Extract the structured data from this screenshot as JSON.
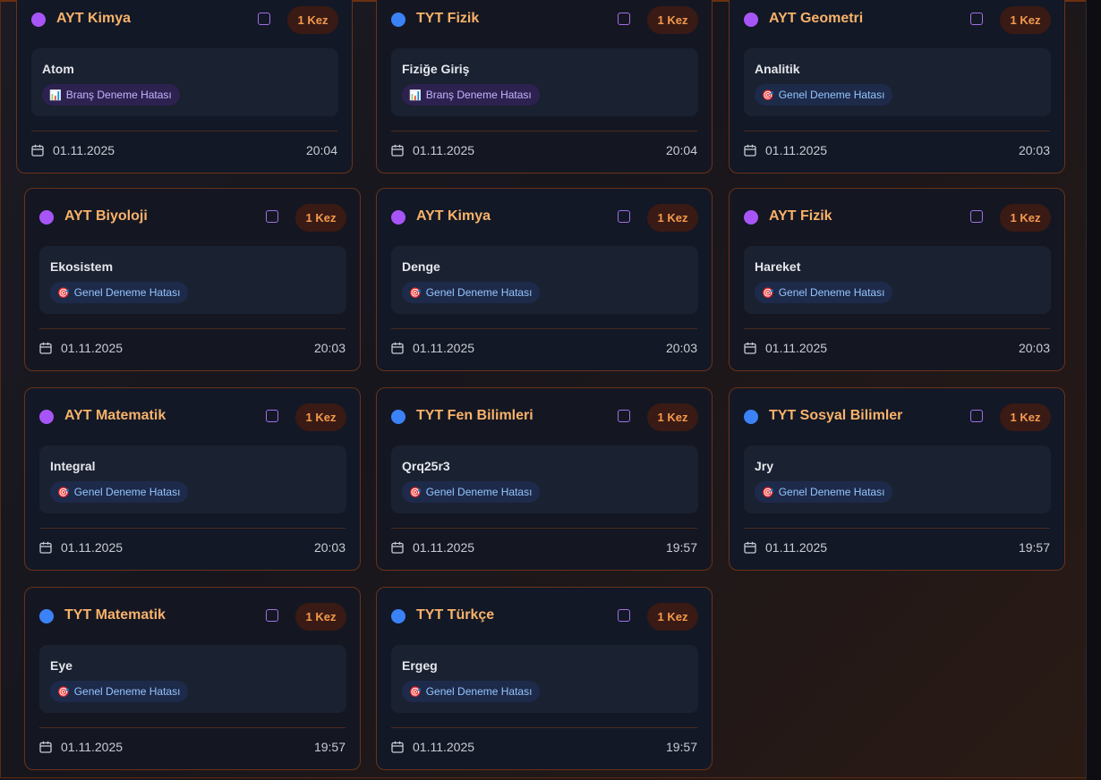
{
  "colors": {
    "ayt_dot": "#a855f7",
    "tyt_dot": "#3b82f6",
    "title": "#f8b26a",
    "badge_text": "#f39a4e"
  },
  "cards": [
    {
      "subject": "AYT Kimya",
      "dot": "ayt",
      "badge": "1 Kez",
      "topic": "Atom",
      "tag_icon": "bar-chart-icon",
      "tag_glyph": "📊",
      "tag": "Branş Deneme Hatası",
      "tag_type": "brans",
      "date": "01.11.2025",
      "time": "20:04"
    },
    {
      "subject": "TYT Fizik",
      "dot": "tyt",
      "badge": "1 Kez",
      "topic": "Fiziğe Giriş",
      "tag_icon": "bar-chart-icon",
      "tag_glyph": "📊",
      "tag": "Branş Deneme Hatası",
      "tag_type": "brans",
      "date": "01.11.2025",
      "time": "20:04"
    },
    {
      "subject": "AYT Geometri",
      "dot": "ayt",
      "badge": "1 Kez",
      "topic": "Analitik",
      "tag_icon": "target-icon",
      "tag_glyph": "🎯",
      "tag": "Genel Deneme Hatası",
      "tag_type": "genel",
      "date": "01.11.2025",
      "time": "20:03"
    },
    {
      "subject": "AYT Biyoloji",
      "dot": "ayt",
      "badge": "1 Kez",
      "topic": "Ekosistem",
      "tag_icon": "target-icon",
      "tag_glyph": "🎯",
      "tag": "Genel Deneme Hatası",
      "tag_type": "genel",
      "date": "01.11.2025",
      "time": "20:03"
    },
    {
      "subject": "AYT Kimya",
      "dot": "ayt",
      "badge": "1 Kez",
      "topic": "Denge",
      "tag_icon": "target-icon",
      "tag_glyph": "🎯",
      "tag": "Genel Deneme Hatası",
      "tag_type": "genel",
      "date": "01.11.2025",
      "time": "20:03"
    },
    {
      "subject": "AYT Fizik",
      "dot": "ayt",
      "badge": "1 Kez",
      "topic": "Hareket",
      "tag_icon": "target-icon",
      "tag_glyph": "🎯",
      "tag": "Genel Deneme Hatası",
      "tag_type": "genel",
      "date": "01.11.2025",
      "time": "20:03"
    },
    {
      "subject": "AYT Matematik",
      "dot": "ayt",
      "badge": "1 Kez",
      "topic": "Integral",
      "tag_icon": "target-icon",
      "tag_glyph": "🎯",
      "tag": "Genel Deneme Hatası",
      "tag_type": "genel",
      "date": "01.11.2025",
      "time": "20:03"
    },
    {
      "subject": "TYT Fen Bilimleri",
      "dot": "tyt",
      "badge": "1 Kez",
      "topic": "Qrq25r3",
      "tag_icon": "target-icon",
      "tag_glyph": "🎯",
      "tag": "Genel Deneme Hatası",
      "tag_type": "genel",
      "date": "01.11.2025",
      "time": "19:57"
    },
    {
      "subject": "TYT Sosyal Bilimler",
      "dot": "tyt",
      "badge": "1 Kez",
      "topic": "Jry",
      "tag_icon": "target-icon",
      "tag_glyph": "🎯",
      "tag": "Genel Deneme Hatası",
      "tag_type": "genel",
      "date": "01.11.2025",
      "time": "19:57"
    },
    {
      "subject": "TYT Matematik",
      "dot": "tyt",
      "badge": "1 Kez",
      "topic": "Eye",
      "tag_icon": "target-icon",
      "tag_glyph": "🎯",
      "tag": "Genel Deneme Hatası",
      "tag_type": "genel",
      "date": "01.11.2025",
      "time": "19:57"
    },
    {
      "subject": "TYT Türkçe",
      "dot": "tyt",
      "badge": "1 Kez",
      "topic": "Ergeg",
      "tag_icon": "target-icon",
      "tag_glyph": "🎯",
      "tag": "Genel Deneme Hatası",
      "tag_type": "genel",
      "date": "01.11.2025",
      "time": "19:57"
    }
  ]
}
